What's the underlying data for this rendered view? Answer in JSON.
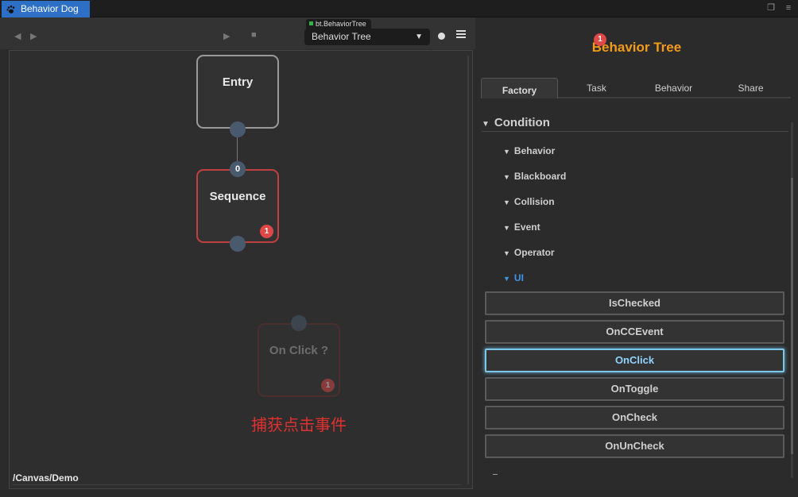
{
  "window": {
    "tab_title": "Behavior Dog"
  },
  "toolbar": {
    "tree_tag": "bt.BehaviorTree",
    "tree_select_value": "Behavior Tree"
  },
  "canvas": {
    "path": "/Canvas/Demo",
    "nodes": {
      "entry": {
        "label": "Entry"
      },
      "sequence": {
        "label": "Sequence",
        "port_index": "0",
        "badge": "1"
      },
      "onclick": {
        "label": "On Click ?",
        "badge": "1"
      }
    },
    "caption": "捕获点击事件"
  },
  "panel": {
    "title": "Behavior Tree",
    "title_badge": "1",
    "tabs": [
      "Factory",
      "Task",
      "Behavior",
      "Share"
    ],
    "section": "Condition",
    "categories": [
      "Behavior",
      "Blackboard",
      "Collision",
      "Event",
      "Operator",
      "UI"
    ],
    "ui_items": [
      "IsChecked",
      "OnCCEvent",
      "OnClick",
      "OnToggle",
      "OnCheck",
      "OnUnCheck"
    ],
    "selected_item": "OnClick"
  },
  "colors": {
    "accent_blue": "#2d6fc4",
    "title_orange": "#f29b1a",
    "error_red": "#e04848",
    "caption_red": "#e03030",
    "selected_cyan": "#7bc7e8"
  }
}
